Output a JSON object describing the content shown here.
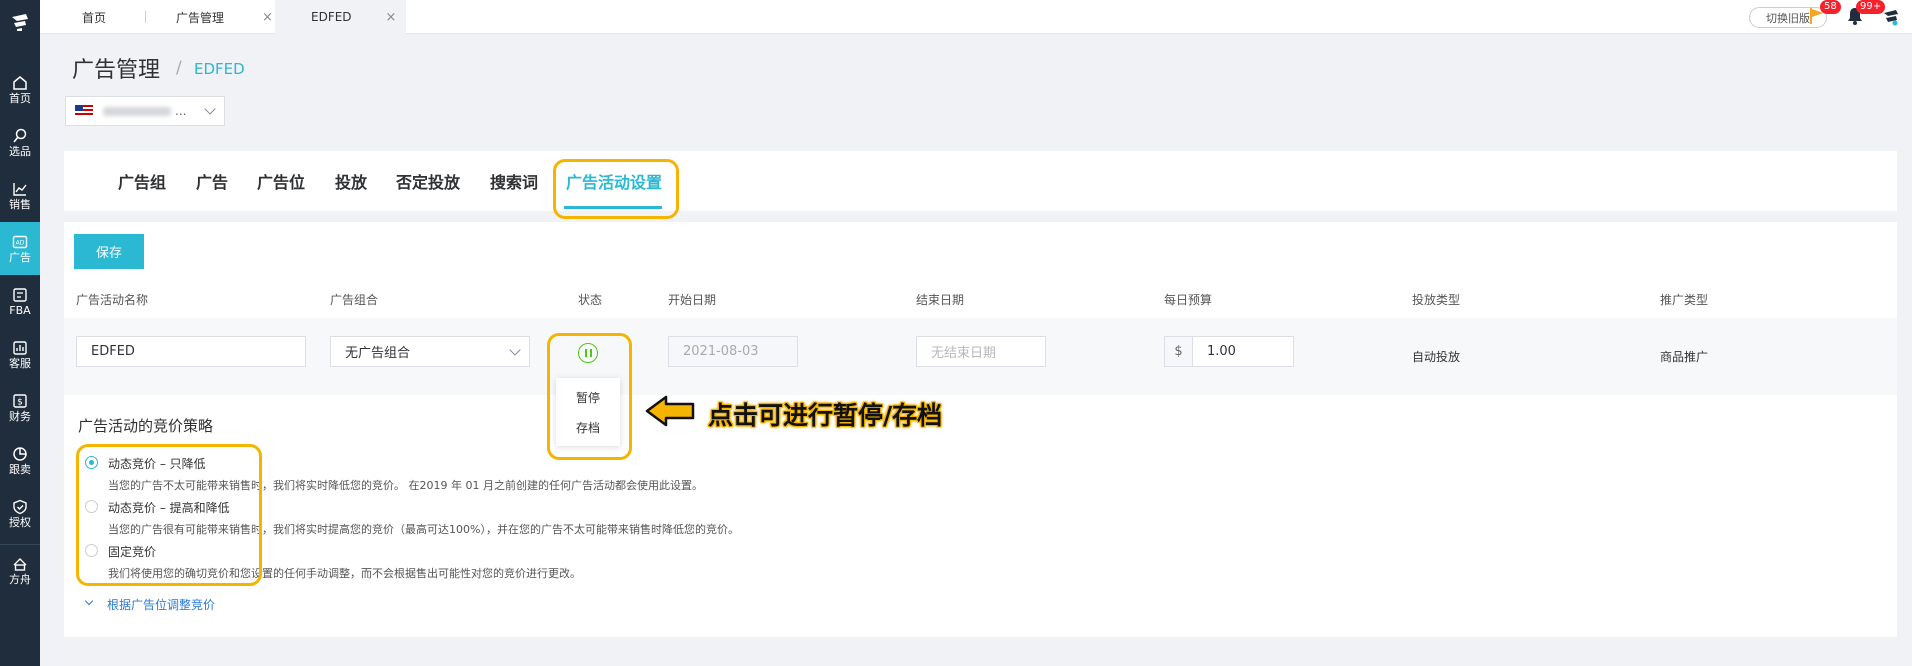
{
  "sidebar": {
    "items": [
      {
        "label": "首页",
        "icon": "home-icon"
      },
      {
        "label": "选品",
        "icon": "search-icon"
      },
      {
        "label": "销售",
        "icon": "chart-icon"
      },
      {
        "label": "广告",
        "icon": "ad-icon",
        "active": true
      },
      {
        "label": "FBA",
        "icon": "fba-icon"
      },
      {
        "label": "客服",
        "icon": "service-icon"
      },
      {
        "label": "财务",
        "icon": "finance-icon"
      },
      {
        "label": "跟卖",
        "icon": "pie-icon"
      },
      {
        "label": "授权",
        "icon": "shield-icon"
      },
      {
        "label": "方舟",
        "icon": "ark-icon"
      }
    ]
  },
  "topbar": {
    "tabs": [
      {
        "label": "首页"
      },
      {
        "label": "广告管理"
      },
      {
        "label": "EDFED",
        "active": true
      }
    ],
    "close_glyph": "×",
    "switch_old_label": "切换旧版",
    "flag_badge": "58",
    "bell_badge": "99+"
  },
  "header": {
    "title": "广告管理",
    "separator": "/",
    "breadcrumb": "EDFED",
    "store_dots": "..."
  },
  "tabs": [
    {
      "label": "广告组"
    },
    {
      "label": "广告"
    },
    {
      "label": "广告位"
    },
    {
      "label": "投放"
    },
    {
      "label": "否定投放"
    },
    {
      "label": "搜索词"
    },
    {
      "label": "广告活动设置",
      "active": true
    }
  ],
  "form": {
    "save_label": "保存",
    "headers": [
      "广告活动名称",
      "广告组合",
      "状态",
      "开始日期",
      "结束日期",
      "每日预算",
      "投放类型",
      "推广类型"
    ],
    "campaign_name": "EDFED",
    "portfolio": "无广告组合",
    "start_date": "2021-08-03",
    "end_date_placeholder": "无结束日期",
    "currency": "$",
    "budget": "1.00",
    "targeting_type": "自动投放",
    "ad_type": "商品推广",
    "status_menu": [
      "暂停",
      "存档"
    ]
  },
  "annotation": {
    "text": "点击可进行暂停/存档",
    "color": "#f5b400"
  },
  "bidding": {
    "title": "广告活动的竞价策略",
    "options": [
      {
        "label": "动态竞价 – 只降低",
        "desc": "当您的广告不太可能带来销售时，我们将实时降低您的竞价。 在2019 年 01 月之前创建的任何广告活动都会使用此设置。",
        "selected": true
      },
      {
        "label": "动态竞价 – 提高和降低",
        "desc": "当您的广告很有可能带来销售时，我们将实时提高您的竞价（最高可达100%），并在您的广告不太可能带来销售时降低您的竞价。",
        "selected": false
      },
      {
        "label": "固定竞价",
        "desc": "我们将使用您的确切竞价和您设置的任何手动调整，而不会根据售出可能性对您的竞价进行更改。",
        "selected": false
      }
    ],
    "adjust_link": "根据广告位调整竞价"
  },
  "colors": {
    "accent": "#2bb8d3",
    "sidebar_bg": "#1f2d3d",
    "highlight": "#f5b400",
    "status_green": "#52c41a"
  }
}
